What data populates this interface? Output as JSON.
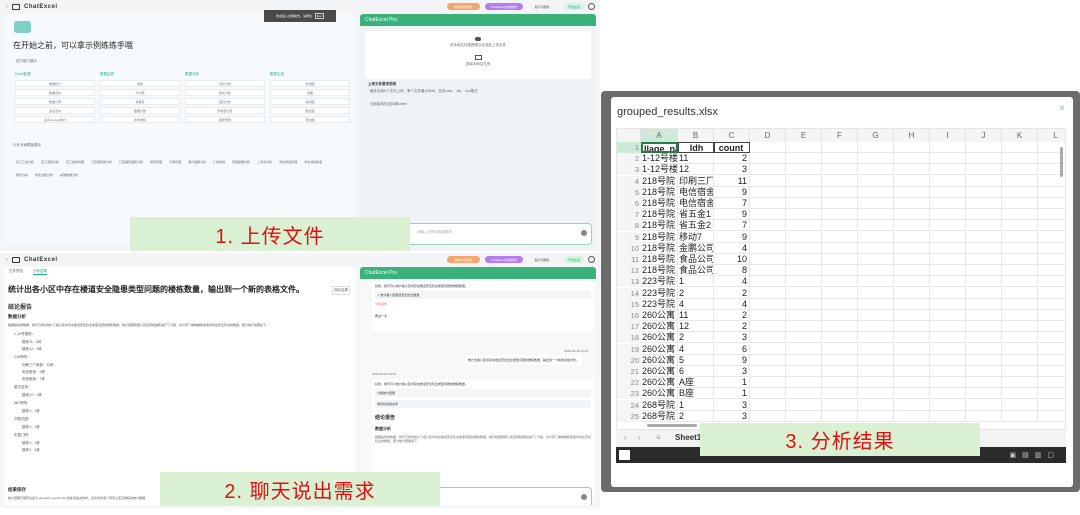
{
  "app": {
    "logo": "ChatExcel",
    "pro_title": "ChatExcel Pro"
  },
  "topbar": {
    "btn_orange": "限时免费体验",
    "btn_purple": "ChatExcel表格操作",
    "btn_help": "提示词帮助",
    "btn_green": "开始会话",
    "toast": "欢迎进入全屏模式，请按住",
    "toast_key": "Esc"
  },
  "panel1": {
    "heading": "在开始之前，可以拿示例练练手哦",
    "section": "官方能力展示",
    "columns": [
      {
        "title": "Excel处理",
        "items": [
          "数据拆分",
          "数据合并",
          "数据计算",
          "多表合并",
          "多表vlookup统计"
        ]
      },
      {
        "title": "数据运算",
        "items": [
          "求和",
          "平均值",
          "求极值",
          "数据计数",
          "条件求和"
        ]
      },
      {
        "title": "数据分析",
        "items": [
          "对比分析",
          "相关分析",
          "回归分析",
          "异常值分析",
          "趋势预测"
        ]
      },
      {
        "title": "图表生成",
        "items": [
          "折线图",
          "饼图",
          "柱状图",
          "散点图",
          "雷达图"
        ]
      }
    ],
    "industry_title": "行业专家模板展示",
    "tags": [
      "员工工资分析",
      "员工离职分析",
      "员工绩效管理",
      "门店销售额分析",
      "门店销售趋势分析",
      "库存管理",
      "订单管理",
      "客户画像分析",
      "广告投放",
      "营销数据分析",
      "二手房分析",
      "学生成绩管理",
      "学生成绩排名",
      "财务分析",
      "学生出勤分析",
      "采购数据分析"
    ],
    "upload_hint": "将本地文件拖拽或点击此处上传文件",
    "select_folder": "选择本地文件夹",
    "upload_rules_title": "上传文件要求说明",
    "upload_rule_1": "最多支持5个文件上传，单个文件最大50M，支持.xlsx、.xls、.csv格式",
    "upload_rule_2": "当前版本仅支持单sheet",
    "input_placeholder": "请输入你的问题或需求",
    "step_label": "1. 上传文件"
  },
  "panel2": {
    "tabs": [
      "文件预览",
      "分析结果"
    ],
    "title": "统计出各小区中存在楼道安全隐患类型问题的楼栋数量，输出到一个新的表格文件。",
    "title_btn": "保存结果",
    "report_title": "结论报告",
    "analysis_title": "数据分析",
    "analysis_text": "根据提供的数据，我们已成功统计了各小区中存在楼道安全隐患类型问题的楼栋数量。统计结果按照小区名称和楼栋进行了分组，并计算了每种楼栋类型中存在安全隐患的数量。部分统计结果如下：",
    "groups": [
      {
        "name": "1-12号楼院：",
        "items": [
          "楼栋11：2栋",
          "楼栋12：3栋"
        ]
      },
      {
        "name": "218号院：",
        "items": [
          "印刷三厂宿舍：11栋",
          "电信宿舍：9栋",
          "电信宿舍：7栋"
        ]
      },
      {
        "name": "星光名苑：",
        "items": [
          "楼栋27：1栋"
        ]
      },
      {
        "name": "367号院：",
        "items": [
          "楼栋1：1栋"
        ]
      },
      {
        "name": "华新花园：",
        "items": [
          "楼栋1：1栋"
        ]
      },
      {
        "name": "东直门院：",
        "items": [
          "楼栋1：1栋",
          "楼栋2：1栋"
        ]
      }
    ],
    "save_title": "结果保存",
    "save_text": "统计结果已保存为名为 grouped_results.xlsx 的新表格文件中。该文件包含了所有小区及楼栋的统计数据。",
    "chat_user_msg": "统计出各小区中存在楼道安全隐患类型问题的楼栋数量，输出到一个新的表格文件。",
    "chat_time1": "2024-05-16 14:23",
    "chat_time2": "2024-05-16 14:24",
    "chat_bot_msg": "好的，我们可以统计各小区中存在楼道安全隐患类型问题的楼栋数量。",
    "step_a": "统计各小区楼道安全隐患数量",
    "step_b": "分组统计结果",
    "step_c": "保存新表格文件",
    "result_label": "分析完成",
    "retry": "再试一次",
    "step_label": "2. 聊天说出需求"
  },
  "sheet": {
    "filename": "grouped_results.xlsx",
    "columns": [
      "A",
      "B",
      "C",
      "D",
      "E",
      "F",
      "G",
      "H",
      "I",
      "J",
      "K",
      "L"
    ],
    "headers": [
      "llage_nam",
      "ldh",
      "count"
    ],
    "rows": [
      [
        "1-12号楼",
        "11",
        "2"
      ],
      [
        "1-12号楼",
        "12",
        "3"
      ],
      [
        "218号院",
        "印刷三厂",
        "11"
      ],
      [
        "218号院",
        "电信宿舍",
        "9"
      ],
      [
        "218号院",
        "电信宿舍",
        "7"
      ],
      [
        "218号院",
        "省五金1",
        "9"
      ],
      [
        "218号院",
        "省五金2",
        "7"
      ],
      [
        "218号院",
        "移动7",
        "9"
      ],
      [
        "218号院",
        "金鹏公司",
        "4"
      ],
      [
        "218号院",
        "食品公司",
        "10"
      ],
      [
        "218号院",
        "食品公司",
        "8"
      ],
      [
        "223号院",
        "1",
        "4"
      ],
      [
        "223号院",
        "2",
        "2"
      ],
      [
        "223号院",
        "4",
        "4"
      ],
      [
        "260公寓",
        "11",
        "2"
      ],
      [
        "260公寓",
        "12",
        "2"
      ],
      [
        "260公寓",
        "2",
        "3"
      ],
      [
        "260公寓",
        "4",
        "6"
      ],
      [
        "260公寓",
        "5",
        "9"
      ],
      [
        "260公寓",
        "6",
        "3"
      ],
      [
        "260公寓",
        "A座",
        "1"
      ],
      [
        "260公寓",
        "B座",
        "1"
      ],
      [
        "268号院",
        "1",
        "3"
      ],
      [
        "268号院",
        "2",
        "3"
      ]
    ],
    "sheet_tab": "Sheet1",
    "step_label": "3. 分析结果"
  }
}
